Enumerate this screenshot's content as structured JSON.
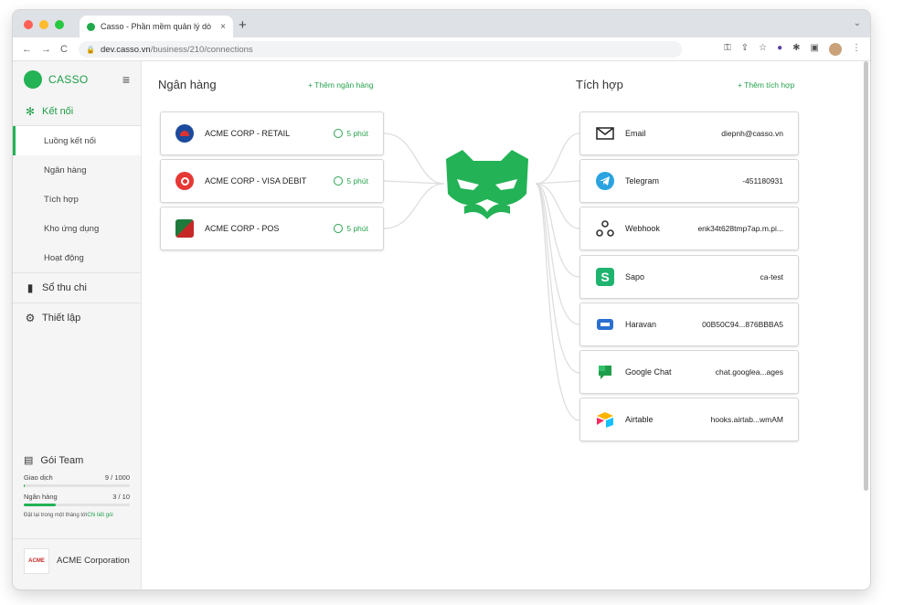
{
  "browser": {
    "tab_title": "Casso - Phần mềm quản lý dò",
    "tab_close": "×",
    "new_tab": "+",
    "url_domain": "dev.casso.vn",
    "url_path": "/business/210/connections",
    "traffic_colors": [
      "#ff5f57",
      "#febc2e",
      "#28c840"
    ]
  },
  "sidebar": {
    "brand": "CASSO",
    "sections": {
      "ket_noi": "Kết nối",
      "so_thu_chi": "Sổ thu chi",
      "thiet_lap": "Thiết lập"
    },
    "sub_items": [
      "Luồng kết nối",
      "Ngân hàng",
      "Tích hợp",
      "Kho ứng dụng",
      "Hoạt động"
    ],
    "plan": {
      "name": "Gói Team",
      "transactions_label": "Giao dịch",
      "transactions_value": "9 / 1000",
      "transactions_fraction": 0.009,
      "banks_label": "Ngân hàng",
      "banks_value": "3 / 10",
      "banks_fraction": 0.3,
      "note": "Đặt lại trong một tháng tới",
      "note_link": "Chi tiết gói"
    },
    "org_name": "ACME Corporation",
    "org_logo_text": "ACME"
  },
  "main": {
    "banks_title": "Ngân hàng",
    "add_bank": "+ Thêm ngân hàng",
    "integrations_title": "Tích hợp",
    "add_integration": "+ Thêm tích hợp",
    "banks": [
      {
        "name": "ACME CORP - RETAIL",
        "time": "5 phút",
        "icon": "vietinbank-icon"
      },
      {
        "name": "ACME CORP - VISA DEBIT",
        "time": "5 phút",
        "icon": "techcombank-icon"
      },
      {
        "name": "ACME CORP - POS",
        "time": "5 phút",
        "icon": "pos-bank-icon"
      }
    ],
    "integrations": [
      {
        "name": "Email",
        "value": "diepnh@casso.vn",
        "icon": "email-icon"
      },
      {
        "name": "Telegram",
        "value": "-451180931",
        "icon": "telegram-icon"
      },
      {
        "name": "Webhook",
        "value": "enk34t628tmp7ap.m.pi...",
        "icon": "webhook-icon"
      },
      {
        "name": "Sapo",
        "value": "ca-test",
        "icon": "sapo-icon"
      },
      {
        "name": "Haravan",
        "value": "00B50C94...876BBBA5",
        "icon": "haravan-icon"
      },
      {
        "name": "Google Chat",
        "value": "chat.googlea...ages",
        "icon": "google-chat-icon"
      },
      {
        "name": "Airtable",
        "value": "hooks.airtab...wmAM",
        "icon": "airtable-icon"
      }
    ]
  },
  "colors": {
    "brand_green": "#23b255",
    "link_green": "#23a24c"
  }
}
